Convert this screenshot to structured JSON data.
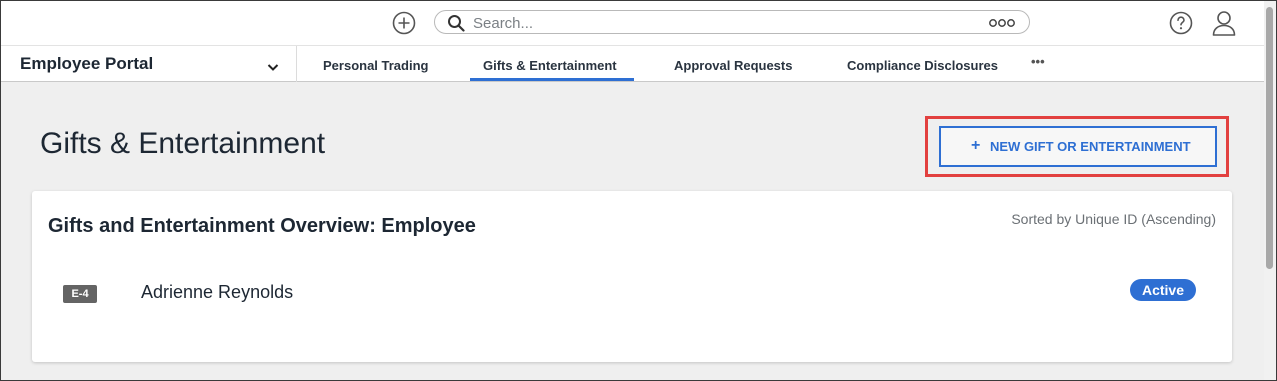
{
  "topbar": {
    "search_placeholder": "Search..."
  },
  "nav": {
    "portal_name": "Employee Portal",
    "tabs": [
      {
        "label": "Personal Trading"
      },
      {
        "label": "Gifts & Entertainment",
        "active": true
      },
      {
        "label": "Approval Requests"
      },
      {
        "label": "Compliance Disclosures"
      }
    ],
    "more_label": "•••"
  },
  "page": {
    "title": "Gifts & Entertainment",
    "new_button_plus": "+",
    "new_button_label": "NEW GIFT OR ENTERTAINMENT"
  },
  "card": {
    "title": "Gifts and Entertainment Overview: Employee",
    "sort_text": "Sorted by Unique ID (Ascending)",
    "rows": [
      {
        "id": "E-4",
        "name": "Adrienne Reynolds",
        "status": "Active"
      }
    ]
  },
  "colors": {
    "accent": "#2e6fd3",
    "highlight": "#e2403f",
    "badge": "#646464"
  },
  "icons": [
    "add-circle-icon",
    "search-icon",
    "options-icon",
    "help-icon",
    "user-icon",
    "chevron-down-icon"
  ]
}
